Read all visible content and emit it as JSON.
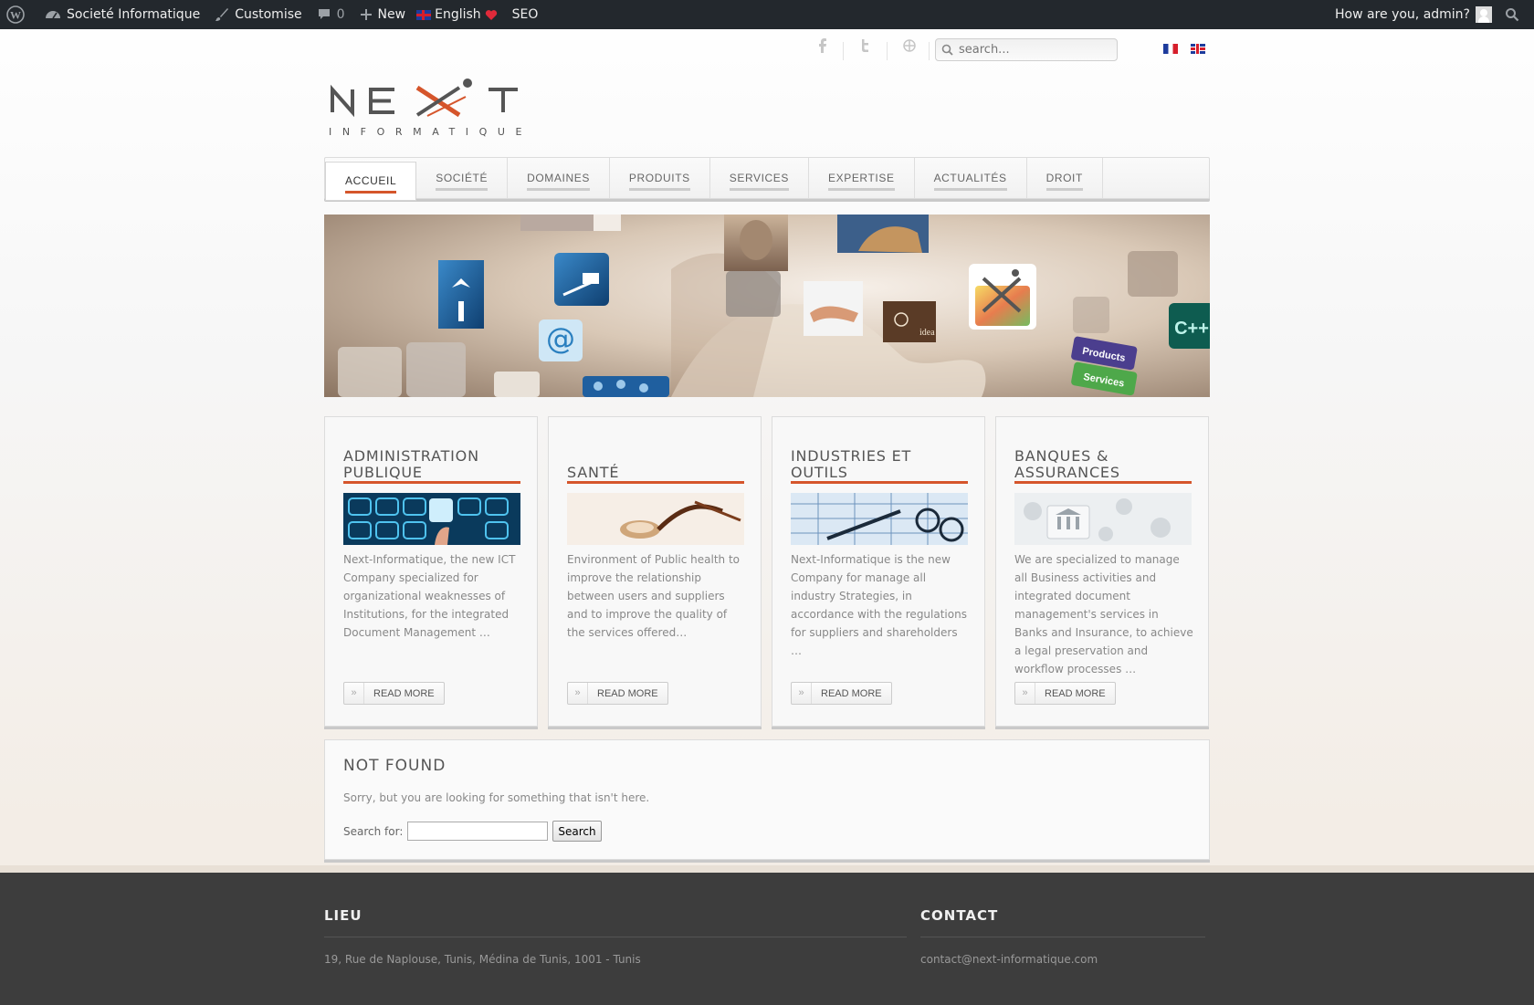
{
  "admin_bar": {
    "site_name": "Societé Informatique",
    "customise": "Customise",
    "comments_count": "0",
    "new": "New",
    "language": "English",
    "seo": "SEO",
    "greeting": "How are you, admin?"
  },
  "search": {
    "placeholder": "search..."
  },
  "languages": [
    "French",
    "English"
  ],
  "logo": {
    "word": "NEXT",
    "tagline": "INFORMATIQUE"
  },
  "nav": {
    "items": [
      "ACCUEIL",
      "SOCIÉTÉ",
      "DOMAINES",
      "PRODUITS",
      "SERVICES",
      "EXPERTISE",
      "ACTUALITÉS",
      "DROIT"
    ],
    "active": "ACCUEIL"
  },
  "hero": {
    "labels": {
      "products": "Products",
      "services": "Services",
      "cpp": "C++"
    }
  },
  "cards": [
    {
      "title": "ADMINISTRATION PUBLIQUE",
      "text": "Next-Informatique, the new ICT Company specialized for organizational weaknesses of Institutions, for the integrated Document Management …",
      "button": "READ MORE"
    },
    {
      "title": "SANTÉ",
      "text": "Environment of Public health to improve the relationship between users and suppliers and to improve the quality of the services offered…",
      "button": "READ MORE"
    },
    {
      "title": "INDUSTRIES ET OUTILS",
      "text": "Next-Informatique is the new Company for manage all industry Strategies, in accordance with the regulations for suppliers and shareholders …",
      "button": "READ MORE"
    },
    {
      "title": "BANQUES & ASSURANCES",
      "text": "We are specialized to manage all Business activities and integrated document management's services in Banks and Insurance, to achieve a legal preservation and workflow processes …",
      "button": "READ MORE"
    }
  ],
  "not_found": {
    "title": "NOT FOUND",
    "message": "Sorry, but you are looking for something that isn't here.",
    "search_label": "Search for:",
    "search_button": "Search"
  },
  "footer": {
    "lieu_title": "LIEU",
    "address": "19, Rue de Naplouse, Tunis, Médina de Tunis, 1001 - Tunis",
    "contact_title": "CONTACT",
    "email": "contact@next-informatique.com"
  },
  "colors": {
    "accent": "#d5552b",
    "admin_bar": "#23282d",
    "footer": "#3d3d3d"
  }
}
